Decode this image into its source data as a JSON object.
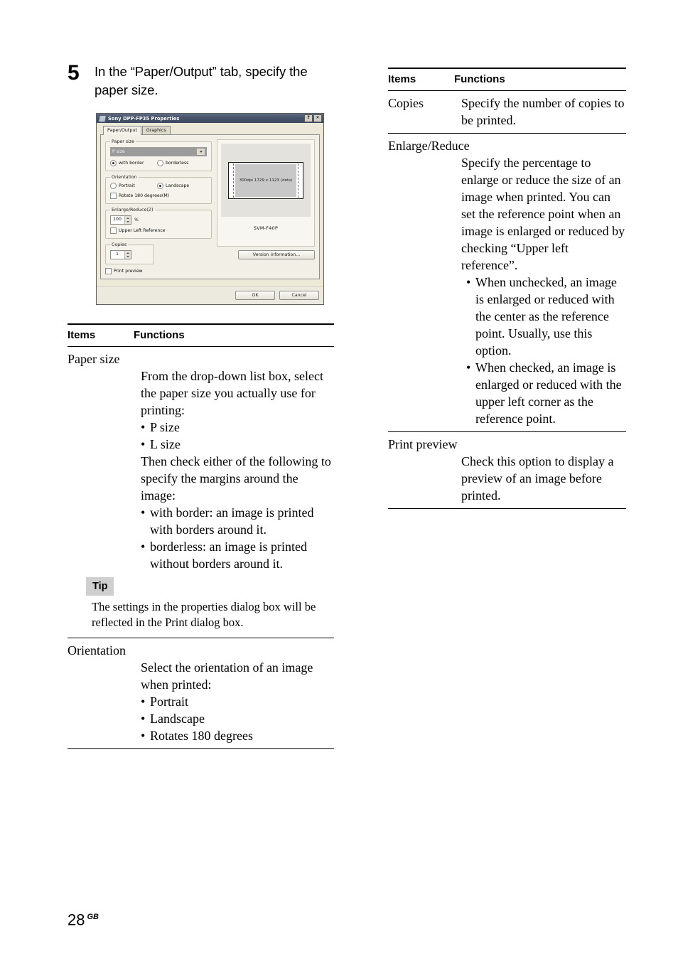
{
  "step": {
    "number": "5",
    "instruction": "In the “Paper/Output” tab, specify the paper size."
  },
  "dialog": {
    "title": "Sony DPP-FP35 Properties",
    "title_icon": "printer-icon",
    "help_button": "?",
    "close_button": "✕",
    "tabs": [
      {
        "label": "Paper/Output",
        "active": true
      },
      {
        "label": "Graphics",
        "active": false
      }
    ],
    "paper_size_group": {
      "legend": "Paper size",
      "selected_value": "P size",
      "border_option_label": "with border",
      "border_option_checked": true,
      "borderless_option_label": "borderless",
      "borderless_option_checked": false
    },
    "orientation_group": {
      "legend": "Orientation",
      "portrait_label": "Portrait",
      "portrait_checked": false,
      "landscape_label": "Landscape",
      "landscape_checked": true,
      "rotate_label": "Rotate 180 degrees(M)",
      "rotate_checked": false
    },
    "enlarge_group": {
      "legend": "Enlarge/Reduce(Z)",
      "value": "100",
      "unit": "%",
      "upper_left_label": "Upper Left Reference",
      "upper_left_checked": false
    },
    "copies_group": {
      "legend": "Copies",
      "value": "1"
    },
    "print_preview_label": "Print preview",
    "print_preview_checked": false,
    "preview": {
      "image_caption": "300dpi 1729 x 1123 (dots)",
      "printer_name": "SVM-F40P"
    },
    "version_button": "Version information...",
    "ok_button": "OK",
    "cancel_button": "Cancel"
  },
  "left_table": {
    "header": {
      "items": "Items",
      "functions": "Functions"
    },
    "rows": [
      {
        "term": "Paper size",
        "paragraphs": [
          "From the drop-down list box, select the paper size you actually use for printing:"
        ],
        "bullets1": [
          "P size",
          "L size"
        ],
        "paragraph2": "Then check either of the following to specify the margins around the image:",
        "bullets2": [
          "with border:  an image is printed with borders around it.",
          "borderless:  an image is printed without borders around it."
        ],
        "tip": {
          "label": "Tip",
          "text": "The settings in the properties dialog box will be reflected in the Print dialog box."
        }
      },
      {
        "term": "Orientation",
        "paragraphs": [
          "Select the orientation of an image when printed:"
        ],
        "bullets1": [
          "Portrait",
          "Landscape",
          "Rotates 180 degrees"
        ]
      }
    ]
  },
  "right_table": {
    "header": {
      "items": "Items",
      "functions": "Functions"
    },
    "rows": [
      {
        "term": "Copies",
        "definition": "Specify the number of copies to be printed."
      },
      {
        "term": "Enlarge/Reduce",
        "definition": "Specify the percentage to enlarge or reduce the size of an image when printed. You can set the reference point when an image is enlarged or reduced by checking “Upper left reference”.",
        "bullets": [
          "When unchecked, an image is enlarged or reduced with the center as the reference point. Usually, use this option.",
          "When checked, an image is enlarged or reduced with the upper left corner as the reference point."
        ]
      },
      {
        "term": "Print preview",
        "definition": "Check this option to display a preview of an image before printed."
      }
    ]
  },
  "footer": {
    "page_number": "28",
    "region_code": "GB"
  }
}
